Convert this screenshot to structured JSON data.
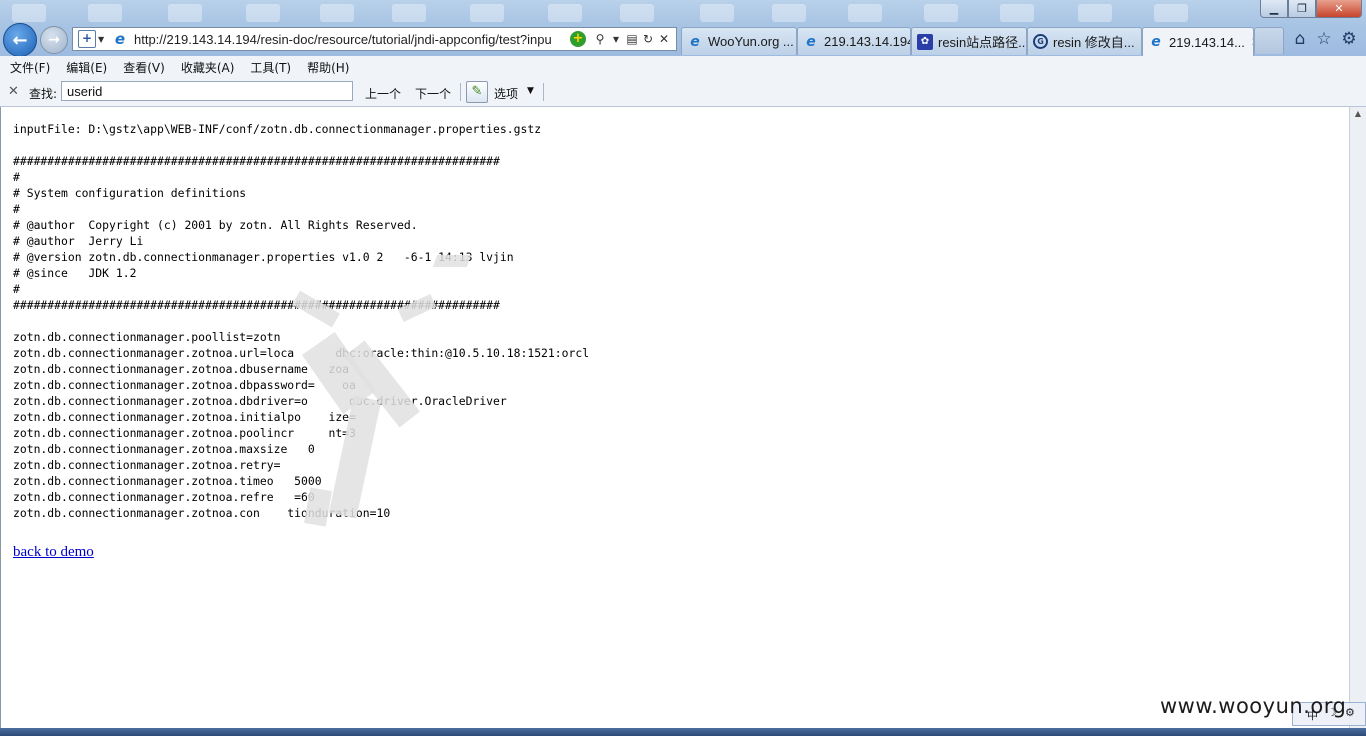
{
  "browser": {
    "url": "http://219.143.14.194/resin-doc/resource/tutorial/jndi-appconfig/test?inpu",
    "tabs": [
      {
        "label": "WooYun.org ...",
        "icon": "ie-icon"
      },
      {
        "label": "219.143.14.194",
        "icon": "ie-icon"
      },
      {
        "label": "resin站点路径...",
        "icon": "baidu-paw-icon"
      },
      {
        "label": "resin 修改自...",
        "icon": "google-icon"
      },
      {
        "label": "219.143.14...",
        "icon": "ie-icon",
        "active": true
      }
    ],
    "tab_close": "✕"
  },
  "menu": {
    "file": "文件(F)",
    "edit": "编辑(E)",
    "view": "查看(V)",
    "favorites": "收藏夹(A)",
    "tools": "工具(T)",
    "help": "帮助(H)"
  },
  "findbar": {
    "label": "查找:",
    "value": "userid",
    "prev": "上一个",
    "next": "下一个",
    "options": "选项"
  },
  "page": {
    "lines": [
      "inputFile: D:\\gstz\\app\\WEB-INF/conf/zotn.db.connectionmanager.properties.gstz",
      "",
      "#######################################################################",
      "#",
      "# System configuration definitions",
      "#",
      "# @author  Copyright (c) 2001 by zotn. All Rights Reserved.",
      "# @author  Jerry Li",
      "# @version zotn.db.connectionmanager.properties v1.0 2   -6-1 14:13 lvjin",
      "# @since   JDK 1.2",
      "#",
      "#######################################################################",
      "",
      "zotn.db.connectionmanager.poollist=zotn",
      "zotn.db.connectionmanager.zotnoa.url=loca      dbc:oracle:thin:@10.5.10.18:1521:orcl",
      "zotn.db.connectionmanager.zotnoa.dbusername   zoa",
      "zotn.db.connectionmanager.zotnoa.dbpassword=    oa",
      "zotn.db.connectionmanager.zotnoa.dbdriver=o      dbc.driver.OracleDriver",
      "zotn.db.connectionmanager.zotnoa.initialpo    ize=",
      "zotn.db.connectionmanager.zotnoa.poolincr     nt=3",
      "zotn.db.connectionmanager.zotnoa.maxsize   0",
      "zotn.db.connectionmanager.zotnoa.retry=",
      "zotn.db.connectionmanager.zotnoa.timeo   5000",
      "zotn.db.connectionmanager.zotnoa.refre   =60",
      "zotn.db.connectionmanager.zotnoa.con    tionduration=10"
    ],
    "back_link": "back to demo"
  },
  "watermark": "www.wooyun.org",
  "tray": {
    "ime": "中"
  }
}
